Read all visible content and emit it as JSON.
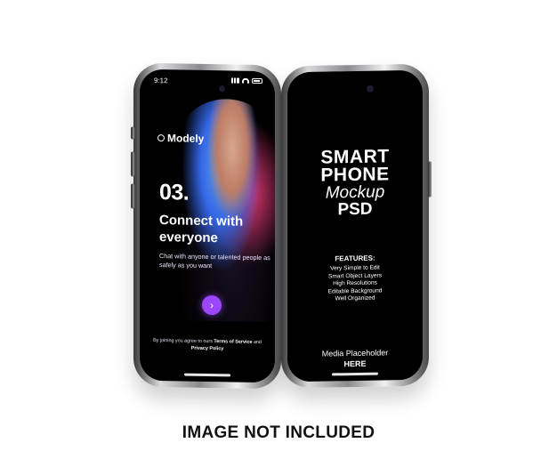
{
  "left_phone": {
    "status_time": "9:12",
    "logo_text": "Modely",
    "step": "03.",
    "headline": "Connect with everyone",
    "subtext": "Chat with anyone or talented people as safely as you want",
    "next_icon": "chevron-right-icon",
    "terms_prefix": "By joining you agree to ours",
    "terms_of_service": "Terms of Service",
    "terms_and": "and",
    "privacy_policy": "Privacy Policy"
  },
  "right_phone": {
    "title_line1": "SMART",
    "title_line2": "PHONE",
    "title_line3": "Mockup",
    "title_line4": "PSD",
    "features_title": "FEATURES:",
    "features": [
      "Very Simple to Edit",
      "Smart Object Layers",
      "High Resolutions",
      "Editable Background",
      "Well Organized"
    ],
    "media_line1": "Media Placeholder",
    "media_line2": "HERE"
  },
  "caption": "IMAGE NOT INCLUDED",
  "colors": {
    "accent_purple": "#9a47ff",
    "background": "#ffffff"
  }
}
